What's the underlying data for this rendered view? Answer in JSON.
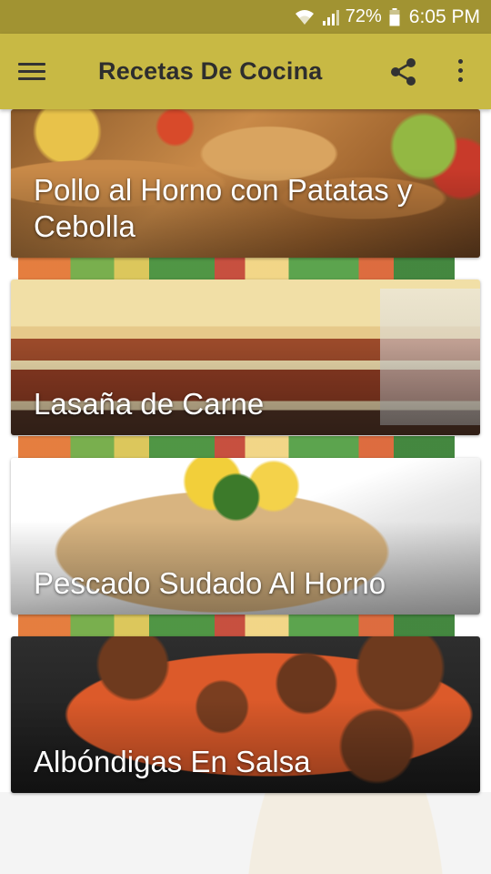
{
  "status_bar": {
    "battery_percent": "72%",
    "time": "6:05 PM",
    "icons": [
      "wifi-icon",
      "cell-signal-icon",
      "battery-icon"
    ]
  },
  "app_bar": {
    "title": "Recetas De Cocina",
    "icons": [
      "menu-icon",
      "share-icon",
      "more-vert-icon"
    ],
    "color": "#c8b944"
  },
  "recipes": [
    {
      "title": "Pollo al Horno con Patatas y Cebolla"
    },
    {
      "title": "Lasaña de Carne"
    },
    {
      "title": "Pescado Sudado Al Horno"
    },
    {
      "title": "Albóndigas En Salsa"
    }
  ],
  "colors": {
    "status_bar": "#a19332",
    "app_bar": "#c8b944",
    "card_text": "#ffffff"
  }
}
